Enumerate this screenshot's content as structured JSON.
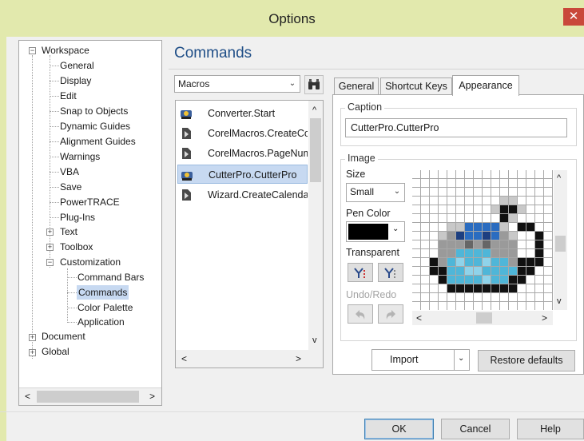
{
  "window": {
    "title": "Options",
    "close_glyph": "✕"
  },
  "tree": {
    "items": [
      {
        "label": "Workspace",
        "expander": "−"
      },
      {
        "label": "General"
      },
      {
        "label": "Display"
      },
      {
        "label": "Edit"
      },
      {
        "label": "Snap to Objects"
      },
      {
        "label": "Dynamic Guides"
      },
      {
        "label": "Alignment Guides"
      },
      {
        "label": "Warnings"
      },
      {
        "label": "VBA"
      },
      {
        "label": "Save"
      },
      {
        "label": "PowerTRACE"
      },
      {
        "label": "Plug-Ins"
      },
      {
        "label": "Text",
        "expander": "+"
      },
      {
        "label": "Toolbox",
        "expander": "+"
      },
      {
        "label": "Customization",
        "expander": "−"
      },
      {
        "label": "Command Bars"
      },
      {
        "label": "Commands",
        "selected": true
      },
      {
        "label": "Color Palette"
      },
      {
        "label": "Application"
      },
      {
        "label": "Document",
        "expander": "+"
      },
      {
        "label": "Global",
        "expander": "+"
      }
    ],
    "scroll_left": "<",
    "scroll_right": ">"
  },
  "page": {
    "heading": "Commands"
  },
  "category": {
    "value": "Macros",
    "arrow": "⌄",
    "find_icon": "binoculars-icon"
  },
  "commands": {
    "items": [
      {
        "label": "Converter.Start",
        "icon": "macro-gear-icon"
      },
      {
        "label": "CorelMacros.CreateCo",
        "icon": "macro-script-icon"
      },
      {
        "label": "CorelMacros.PageNum",
        "icon": "macro-script-icon"
      },
      {
        "label": "CutterPro.CutterPro",
        "icon": "macro-gear-icon",
        "selected": true
      },
      {
        "label": "Wizard.CreateCalenda",
        "icon": "macro-script-icon"
      }
    ],
    "scroll_up": "^",
    "scroll_down": "v",
    "scroll_left": "<",
    "scroll_right": ">"
  },
  "tabs": [
    {
      "label": "General"
    },
    {
      "label": "Shortcut Keys"
    },
    {
      "label": "Appearance",
      "active": true
    }
  ],
  "caption": {
    "label": "Caption",
    "value": "CutterPro.CutterPro"
  },
  "image": {
    "label": "Image",
    "size_label": "Size",
    "size_value": "Small",
    "pen_color_label": "Pen Color",
    "pen_color": "#000000",
    "transparent_label": "Transparent",
    "undo_redo_label": "Undo/Redo"
  },
  "buttons": {
    "import": "Import",
    "restore": "Restore defaults",
    "ok": "OK",
    "cancel": "Cancel",
    "help": "Help"
  },
  "colors": {
    "accent_heading": "#1f4e87",
    "selection": "#c7d9f1",
    "titlebar": "#e2e9ad",
    "close": "#c9483a"
  }
}
